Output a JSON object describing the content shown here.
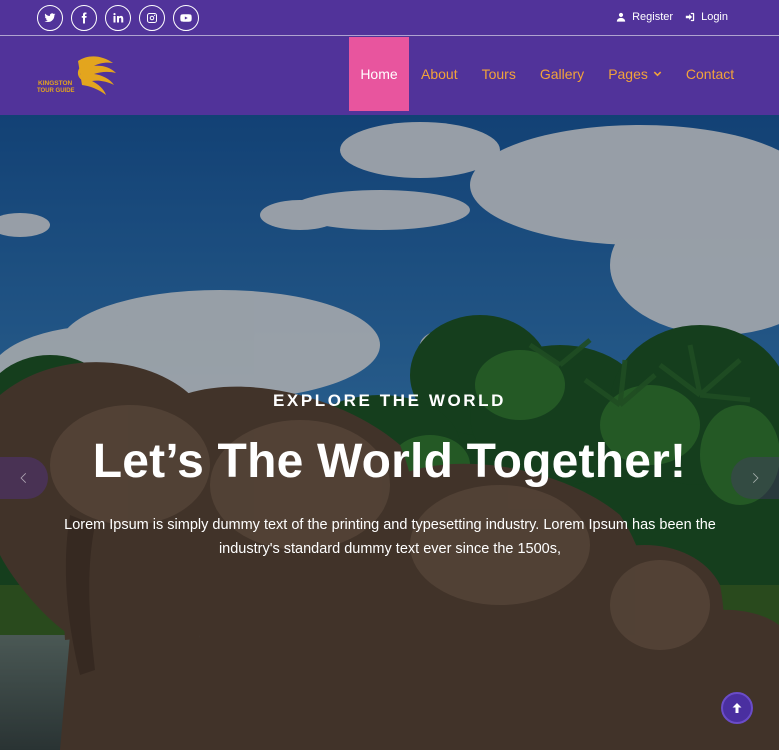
{
  "topbar": {
    "social": [
      {
        "icon": "twitter-icon"
      },
      {
        "icon": "facebook-icon"
      },
      {
        "icon": "linkedin-icon"
      },
      {
        "icon": "instagram-icon"
      },
      {
        "icon": "youtube-icon"
      }
    ],
    "register_label": "Register",
    "login_label": "Login"
  },
  "brand": {
    "line1": "KINGSTON",
    "line2": "TOUR GUIDE",
    "colors": {
      "gold": "#e3a51e"
    }
  },
  "nav": {
    "items": [
      {
        "label": "Home",
        "active": true
      },
      {
        "label": "About"
      },
      {
        "label": "Tours"
      },
      {
        "label": "Gallery"
      },
      {
        "label": "Pages",
        "has_dropdown": true
      },
      {
        "label": "Contact"
      }
    ]
  },
  "hero": {
    "eyebrow": "EXPLORE THE WORLD",
    "headline": "Let’s The World Together!",
    "lead": "Lorem Ipsum is simply dummy text of the printing and typesetting industry. Lorem Ipsum has been the industry's standard dummy text ever since the 1500s,"
  },
  "colors": {
    "brand_purple": "#51339a",
    "active_pink": "#e8559e",
    "nav_orange": "#f2a33a"
  }
}
